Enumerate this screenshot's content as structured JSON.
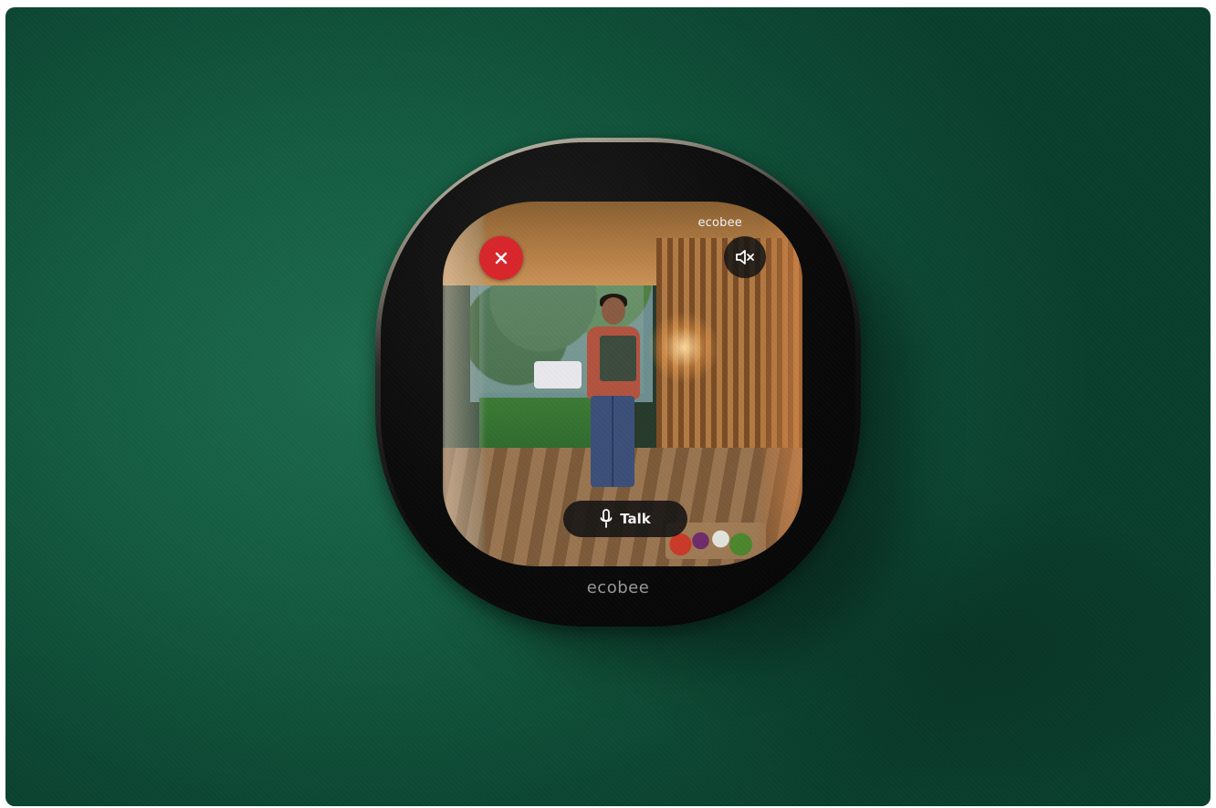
{
  "device": {
    "brand_label": "ecobee"
  },
  "screen": {
    "brand_label": "ecobee",
    "close_button": {
      "icon": "close-icon",
      "color": "#d8262c"
    },
    "mute_button": {
      "icon": "speaker-muted-icon"
    },
    "talk_button": {
      "label": "Talk",
      "icon": "microphone-icon"
    }
  },
  "colors": {
    "wall": "#135a40",
    "device_body": "#0a0a0a",
    "close_accent": "#d8262c"
  }
}
